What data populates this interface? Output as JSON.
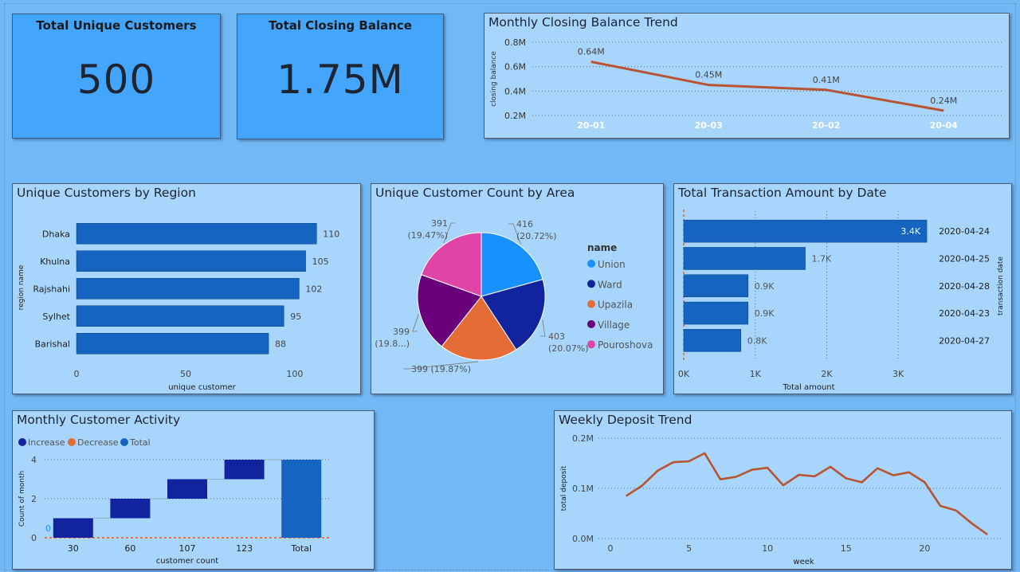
{
  "kpi": {
    "customers": {
      "title": "Total Unique Customers",
      "value": "500"
    },
    "balance": {
      "title": "Total Closing Balance",
      "value": "1.75M"
    }
  },
  "colors": {
    "bar": "#1565c0",
    "line": "#b85432",
    "union": "#1890ff",
    "ward": "#12239e",
    "upazila": "#e66c37",
    "village": "#6b007b",
    "pouroshova": "#e044a7",
    "increase": "#12239e",
    "decrease": "#e66c37",
    "total": "#1565c0"
  },
  "chart_data": [
    {
      "id": "monthly-balance",
      "type": "line",
      "title": "Monthly Closing Balance Trend",
      "xlabel": "",
      "ylabel": "closing balance",
      "categories": [
        "20-01",
        "20-03",
        "20-02",
        "20-04"
      ],
      "values": [
        0.64,
        0.45,
        0.41,
        0.24
      ],
      "data_labels": [
        "0.64M",
        "0.45M",
        "0.41M",
        "0.24M"
      ],
      "ylim": [
        0.2,
        0.8
      ],
      "yticks": [
        "0.2M",
        "0.4M",
        "0.6M",
        "0.8M"
      ],
      "ytick_values": [
        0.2,
        0.4,
        0.6,
        0.8
      ],
      "grid": true
    },
    {
      "id": "customers-region",
      "type": "bar",
      "title": "Unique Customers by Region",
      "xlabel": "unique customer",
      "ylabel": "region name",
      "categories": [
        "Dhaka",
        "Khulna",
        "Rajshahi",
        "Sylhet",
        "Barishal"
      ],
      "values": [
        110,
        105,
        102,
        95,
        88
      ],
      "xlim": [
        0,
        115
      ],
      "xticks": [
        "0",
        "50",
        "100"
      ],
      "xtick_values": [
        0,
        50,
        100
      ]
    },
    {
      "id": "customers-area",
      "type": "pie",
      "title": "Unique Customer Count by Area",
      "legend_title": "name",
      "legend_position": "right",
      "labels": [
        "Union",
        "Ward",
        "Upazila",
        "Village",
        "Pouroshova"
      ],
      "values": [
        416,
        403,
        399,
        399,
        391
      ],
      "slice_labels": [
        [
          "416",
          "(20.72%)"
        ],
        [
          "403",
          "(20.07%)"
        ],
        [
          "399 (19.87%)"
        ],
        [
          "399",
          "(19.8...)"
        ],
        [
          "391",
          "(19.47%)"
        ]
      ]
    },
    {
      "id": "transaction-date",
      "type": "bar",
      "title": "Total Transaction Amount by Date",
      "xlabel": "Total amount",
      "ylabel": "transaction date",
      "categories": [
        "2020-04-24",
        "2020-04-25",
        "2020-04-28",
        "2020-04-23",
        "2020-04-27"
      ],
      "values": [
        3.4,
        1.7,
        0.9,
        0.9,
        0.8
      ],
      "data_labels": [
        "3.4K",
        "1.7K",
        "0.9K",
        "0.9K",
        "0.8K"
      ],
      "xlim": [
        0,
        3.6
      ],
      "xticks": [
        "0K",
        "1K",
        "2K",
        "3K"
      ],
      "xtick_values": [
        0,
        1,
        2,
        3
      ],
      "grid": true
    },
    {
      "id": "customer-activity",
      "type": "bar",
      "subtype": "waterfall",
      "title": "Monthly Customer Activity",
      "xlabel": "customer count",
      "ylabel": "Count of month",
      "legend": [
        "Increase",
        "Decrease",
        "Total"
      ],
      "legend_position": "top-left",
      "categories": [
        "30",
        "60",
        "107",
        "123",
        "Total"
      ],
      "values": [
        1,
        1,
        1,
        1,
        4
      ],
      "start_label": "0",
      "ylim": [
        0,
        4.5
      ],
      "yticks": [
        "0",
        "2",
        "4"
      ],
      "ytick_values": [
        0,
        2,
        4
      ]
    },
    {
      "id": "weekly-deposit",
      "type": "line",
      "title": "Weekly Deposit Trend",
      "xlabel": "week",
      "ylabel": "total deposit",
      "x": [
        1,
        2,
        3,
        4,
        5,
        6,
        7,
        8,
        9,
        10,
        11,
        12,
        13,
        14,
        15,
        16,
        17,
        18,
        19,
        20,
        21,
        22,
        23,
        24
      ],
      "values": [
        0.085,
        0.105,
        0.135,
        0.152,
        0.154,
        0.17,
        0.118,
        0.123,
        0.137,
        0.141,
        0.106,
        0.127,
        0.124,
        0.143,
        0.12,
        0.112,
        0.14,
        0.126,
        0.132,
        0.112,
        0.065,
        0.056,
        0.03,
        0.008
      ],
      "xlim": [
        0,
        25
      ],
      "ylim": [
        0,
        0.2
      ],
      "xticks": [
        "0",
        "5",
        "10",
        "15",
        "20"
      ],
      "xtick_values": [
        0,
        5,
        10,
        15,
        20
      ],
      "yticks": [
        "0.0M",
        "0.1M",
        "0.2M"
      ],
      "ytick_values": [
        0,
        0.1,
        0.2
      ],
      "grid": true
    }
  ]
}
